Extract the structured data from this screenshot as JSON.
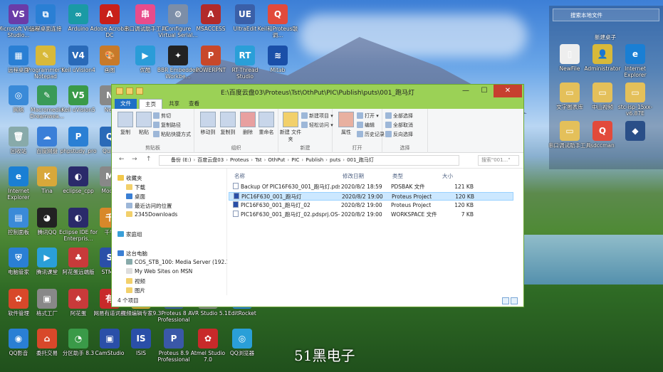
{
  "desktop": {
    "left_icons": [
      {
        "label": "Microsoft Visual Studio...",
        "color": "#6a3ca8",
        "glyph": "VS"
      },
      {
        "label": "远程桌面连接",
        "color": "#2a7fd4",
        "glyph": "⧉"
      },
      {
        "label": "Arduino",
        "color": "#1a9aa5",
        "glyph": "∞"
      },
      {
        "label": "Adobe Acrobat DC",
        "color": "#c8201a",
        "glyph": "A"
      },
      {
        "label": "串口调试助手工具",
        "color": "#e84c8b",
        "glyph": "串"
      },
      {
        "label": "Configure Virtual Serial...",
        "color": "#7c8ea8",
        "glyph": "⚙"
      },
      {
        "label": "MSACCESS",
        "color": "#b22a2a",
        "glyph": "A"
      },
      {
        "label": "UltraEdit",
        "color": "#3a5fa8",
        "glyph": "UE"
      },
      {
        "label": "Keil和Proteus联调...",
        "color": "#e24a3b",
        "glyph": "Q"
      },
      {
        "label": "远程桌面",
        "color": "#2a7fd4",
        "glyph": "▦"
      },
      {
        "label": "Programmer's Notepad",
        "color": "#d8b93a",
        "glyph": "✎"
      },
      {
        "label": "Keil uVision4",
        "color": "#2a6ab8",
        "glyph": "V4"
      },
      {
        "label": "画图",
        "color": "#c77a2a",
        "glyph": "🎨"
      },
      {
        "label": "优酷",
        "color": "#2a9cd8",
        "glyph": "▶"
      },
      {
        "label": "BBR Embedded Workbe...",
        "color": "#222",
        "glyph": "✦"
      },
      {
        "label": "POWERPNT",
        "color": "#c8482a",
        "glyph": "P"
      },
      {
        "label": "RT-Thread Studio",
        "color": "#2a9fd8",
        "glyph": "RT"
      },
      {
        "label": "Mitab",
        "color": "#1a4fa8",
        "glyph": "≋"
      },
      {
        "label": "网络",
        "color": "#3a8ad8",
        "glyph": "◎"
      },
      {
        "label": "Macromedia Dreamwea...",
        "color": "#3a9a58",
        "glyph": "✎"
      },
      {
        "label": "Keil uVision5",
        "color": "#3a9a48",
        "glyph": "V5"
      },
      {
        "label": "Nex",
        "color": "#888",
        "glyph": "N"
      },
      {
        "label": "回收站",
        "color": "#8aa",
        "glyph": "🗑"
      },
      {
        "label": "百度网盘",
        "color": "#3a7fd8",
        "glyph": "☁"
      },
      {
        "label": "phpstudy_pro",
        "color": "#2a7fd4",
        "glyph": "P"
      },
      {
        "label": "Qui...",
        "color": "#2a6ab8",
        "glyph": "Q"
      },
      {
        "label": "Internet Explorer",
        "color": "#1a7fd4",
        "glyph": "e"
      },
      {
        "label": "Tina",
        "color": "#d8a83a",
        "glyph": "K"
      },
      {
        "label": "eclipse_cpp",
        "color": "#2a2a6a",
        "glyph": "◐"
      },
      {
        "label": "Mod...",
        "color": "#888",
        "glyph": "M"
      },
      {
        "label": "控制面板",
        "color": "#3a8ad8",
        "glyph": "▤"
      },
      {
        "label": "腾讯QQ",
        "color": "#222",
        "glyph": "◕"
      },
      {
        "label": "Eclipse IDE for Enterpris...",
        "color": "#2a2a6a",
        "glyph": "◐"
      },
      {
        "label": "千牛",
        "color": "#d8882a",
        "glyph": "千"
      },
      {
        "label": "电脑管家",
        "color": "#2a7fd4",
        "glyph": "⛨"
      },
      {
        "label": "腾讯课堂",
        "color": "#2a9fd8",
        "glyph": "▶"
      },
      {
        "label": "阿花蛋远端版",
        "color": "#c83a3a",
        "glyph": "♣"
      },
      {
        "label": "STM...",
        "color": "#2a4fa8",
        "glyph": "S"
      },
      {
        "label": "软件管理",
        "color": "#d8482a",
        "glyph": "✿"
      },
      {
        "label": "格式工厂",
        "color": "#888",
        "glyph": "▣"
      },
      {
        "label": "阿花蛋",
        "color": "#c83a3a",
        "glyph": "♠"
      },
      {
        "label": "网易有道词典",
        "color": "#c82a2a",
        "glyph": "有"
      },
      {
        "label": "视频编辑专家9.3",
        "color": "#d8a83a",
        "glyph": "▶"
      },
      {
        "label": "Proteus 8 Professional",
        "color": "#3a58a8",
        "glyph": "P"
      },
      {
        "label": "AVR Studio 5.1",
        "color": "#888",
        "glyph": "A"
      },
      {
        "label": "EditRocket",
        "color": "#2a7fd4",
        "glyph": "R"
      },
      {
        "label": "QQ影音",
        "color": "#2a7fd4",
        "glyph": "◉"
      },
      {
        "label": "委托交易",
        "color": "#d8482a",
        "glyph": "⌂"
      },
      {
        "label": "分区助手 8.3",
        "color": "#3a9a48",
        "glyph": "◔"
      },
      {
        "label": "CamStudio",
        "color": "#2a4fa8",
        "glyph": "▣"
      },
      {
        "label": "ISIS",
        "color": "#2a4fa8",
        "glyph": "IS"
      },
      {
        "label": "Proteus 8.9 Professional",
        "color": "#3a58a8",
        "glyph": "P"
      },
      {
        "label": "Atmel Studio 7.0",
        "color": "#c82a2a",
        "glyph": "✿"
      },
      {
        "label": "QQ浏览器",
        "color": "#2a9fd8",
        "glyph": "◎"
      }
    ],
    "right_panel": {
      "search_placeholder": "搜索本地文件",
      "folder_title": "新建桌子",
      "icons": [
        {
          "label": "NewFile",
          "color": "#eee",
          "glyph": "▯"
        },
        {
          "label": "Administrator",
          "color": "#d8b93a",
          "glyph": "👤"
        },
        {
          "label": "Internet Explorer",
          "color": "#1a7fd4",
          "glyph": "e"
        },
        {
          "label": "文字图表库",
          "color": "#e4c05a",
          "glyph": "▭"
        },
        {
          "label": "中山视频",
          "color": "#e4c05a",
          "glyph": "▭"
        },
        {
          "label": "stc-isp-15xx-v6.87E",
          "color": "#e4c05a",
          "glyph": "▭"
        },
        {
          "label": "串口调试助手工具",
          "color": "#e4c05a",
          "glyph": "▭"
        },
        {
          "label": "sdccman",
          "color": "#e24a3b",
          "glyph": "Q"
        },
        {
          "label": "",
          "color": "#2a4f88",
          "glyph": "◆"
        }
      ]
    },
    "watermark": "51黑电子"
  },
  "window": {
    "title": "E:\\百度云盘03\\Proteus\\Tst\\OthPut\\PIC\\Publish\\puts\\001_跑马灯",
    "controls": {
      "minimize": "—",
      "maximize": "☐",
      "close": "✕"
    },
    "tabs": {
      "file": "文件",
      "home": "主页",
      "share": "共享",
      "view": "查看"
    },
    "ribbon": {
      "clipboard": {
        "label": "剪贴板",
        "copy": "复制",
        "paste": "粘贴",
        "cut": "剪切",
        "copy_path": "复制路径",
        "paste_shortcut": "粘贴快捷方式"
      },
      "organize": {
        "label": "组织",
        "move_to": "移动到",
        "copy_to": "复制到",
        "delete": "删除",
        "rename": "重命名"
      },
      "new": {
        "label": "新建",
        "new_folder": "新建\n文件夹",
        "new_item": "新建项目 ▾",
        "easy_access": "轻松访问 ▾"
      },
      "open": {
        "label": "打开",
        "properties": "属性",
        "open": "打开 ▾",
        "edit": "编辑",
        "history": "历史记录"
      },
      "select": {
        "label": "选择",
        "select_all": "全部选择",
        "select_none": "全部取消",
        "invert": "反向选择"
      }
    },
    "address": {
      "back": "←",
      "forward": "→",
      "up": "↑",
      "crumbs": [
        "备份 (E:)",
        "百度云盘03",
        "Proteus",
        "Tst",
        "OthPut",
        "PIC",
        "Publish",
        "puts",
        "001_跑马灯"
      ],
      "search_placeholder": "搜索\"001...\""
    },
    "nav_pane": {
      "favorites": "收藏夹",
      "downloads": "下载",
      "desktop": "桌面",
      "recent": "最近访问的位置",
      "item_2345": "2345Downloads",
      "homegroup": "家庭组",
      "this_pc": "这台电脑",
      "media_server": "COS_STB_100: Media Server (192.1...",
      "msn": "My Web Sites on MSN",
      "videos": "视频",
      "pictures": "图片"
    },
    "columns": {
      "name": "名称",
      "modified": "修改日期",
      "type": "类型",
      "size": "大小"
    },
    "files": [
      {
        "name": "Backup Of PIC16F630_001_跑马灯.pds...",
        "date": "2020/8/2 18:59",
        "type": "PDSBAK 文件",
        "size": "121 KB",
        "icon": "#ffffff"
      },
      {
        "name": "PIC16F630_001_跑马灯",
        "date": "2020/8/2 19:00",
        "type": "Proteus Project",
        "size": "120 KB",
        "icon": "#2a4fa8"
      },
      {
        "name": "PIC16F630_001_跑马灯_02",
        "date": "2020/8/2 19:00",
        "type": "Proteus Project",
        "size": "120 KB",
        "icon": "#2a4fa8"
      },
      {
        "name": "PIC16F630_001_跑马灯_02.pdsprj.OS-...",
        "date": "2020/8/2 19:00",
        "type": "WORKSPACE 文件",
        "size": "7 KB",
        "icon": "#ffffff"
      }
    ],
    "status": "4 个项目"
  }
}
